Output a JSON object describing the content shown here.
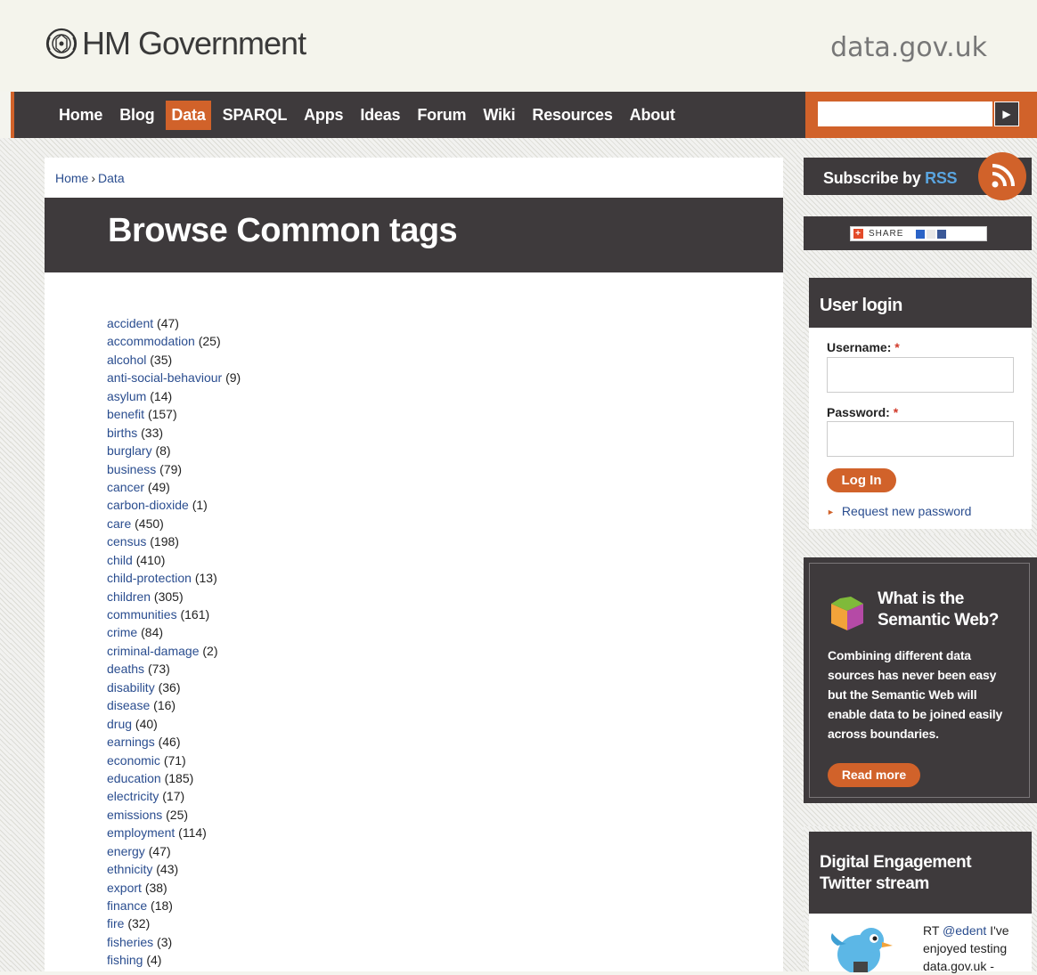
{
  "header": {
    "logo_text": "HM Government",
    "site_name": "data.gov.uk"
  },
  "nav": {
    "items": [
      {
        "label": "Home"
      },
      {
        "label": "Blog"
      },
      {
        "label": "Data",
        "active": true
      },
      {
        "label": "SPARQL"
      },
      {
        "label": "Apps"
      },
      {
        "label": "Ideas"
      },
      {
        "label": "Forum"
      },
      {
        "label": "Wiki"
      },
      {
        "label": "Resources"
      },
      {
        "label": "About"
      }
    ]
  },
  "search": {
    "value": "",
    "button_icon": "play-arrow-icon"
  },
  "breadcrumb": {
    "home": "Home",
    "separator": "›",
    "current": "Data"
  },
  "page": {
    "title": "Browse Common tags"
  },
  "tags": [
    {
      "name": "accident",
      "count": "(47)"
    },
    {
      "name": "accommodation",
      "count": "(25)"
    },
    {
      "name": "alcohol",
      "count": "(35)"
    },
    {
      "name": "anti-social-behaviour",
      "count": "(9)"
    },
    {
      "name": "asylum",
      "count": "(14)"
    },
    {
      "name": "benefit",
      "count": "(157)"
    },
    {
      "name": "births",
      "count": "(33)"
    },
    {
      "name": "burglary",
      "count": "(8)"
    },
    {
      "name": "business",
      "count": "(79)"
    },
    {
      "name": "cancer",
      "count": "(49)"
    },
    {
      "name": "carbon-dioxide",
      "count": "(1)"
    },
    {
      "name": "care",
      "count": "(450)"
    },
    {
      "name": "census",
      "count": "(198)"
    },
    {
      "name": "child",
      "count": "(410)"
    },
    {
      "name": "child-protection",
      "count": "(13)"
    },
    {
      "name": "children",
      "count": "(305)"
    },
    {
      "name": "communities",
      "count": "(161)"
    },
    {
      "name": "crime",
      "count": "(84)"
    },
    {
      "name": "criminal-damage",
      "count": "(2)"
    },
    {
      "name": "deaths",
      "count": "(73)"
    },
    {
      "name": "disability",
      "count": "(36)"
    },
    {
      "name": "disease",
      "count": "(16)"
    },
    {
      "name": "drug",
      "count": "(40)"
    },
    {
      "name": "earnings",
      "count": "(46)"
    },
    {
      "name": "economic",
      "count": "(71)"
    },
    {
      "name": "education",
      "count": "(185)"
    },
    {
      "name": "electricity",
      "count": "(17)"
    },
    {
      "name": "emissions",
      "count": "(25)"
    },
    {
      "name": "employment",
      "count": "(114)"
    },
    {
      "name": "energy",
      "count": "(47)"
    },
    {
      "name": "ethnicity",
      "count": "(43)"
    },
    {
      "name": "export",
      "count": "(38)"
    },
    {
      "name": "finance",
      "count": "(18)"
    },
    {
      "name": "fire",
      "count": "(32)"
    },
    {
      "name": "fisheries",
      "count": "(3)"
    },
    {
      "name": "fishing",
      "count": "(4)"
    }
  ],
  "sidebar": {
    "rss": {
      "prefix": "Subscribe by ",
      "accent": "RSS",
      "icon": "rss-icon"
    },
    "share": {
      "label": "SHARE",
      "icon": "share-plus-icon"
    },
    "login": {
      "title": "User login",
      "username_label": "Username:",
      "password_label": "Password:",
      "required_mark": "*",
      "username_value": "",
      "password_value": "",
      "button_label": "Log In",
      "request_link": "Request new password"
    },
    "semantic": {
      "title": "What is the Semantic Web?",
      "text": "Combining different data sources has never been easy but the Semantic Web will enable data to be joined easily across boundaries.",
      "button_label": "Read more",
      "icon": "semantic-cube-icon"
    },
    "twitter": {
      "title": "Digital Engagement Twitter stream",
      "tweet_prefix": "RT ",
      "tweet_handle": "@edent",
      "tweet_text": " I've enjoyed testing data.gov.uk -",
      "icon": "twitter-bird-icon"
    }
  },
  "colors": {
    "accent": "#d1622a",
    "dark": "#3e3a3c",
    "link": "#2a4d8f",
    "rss_blue": "#5aa5e0"
  }
}
